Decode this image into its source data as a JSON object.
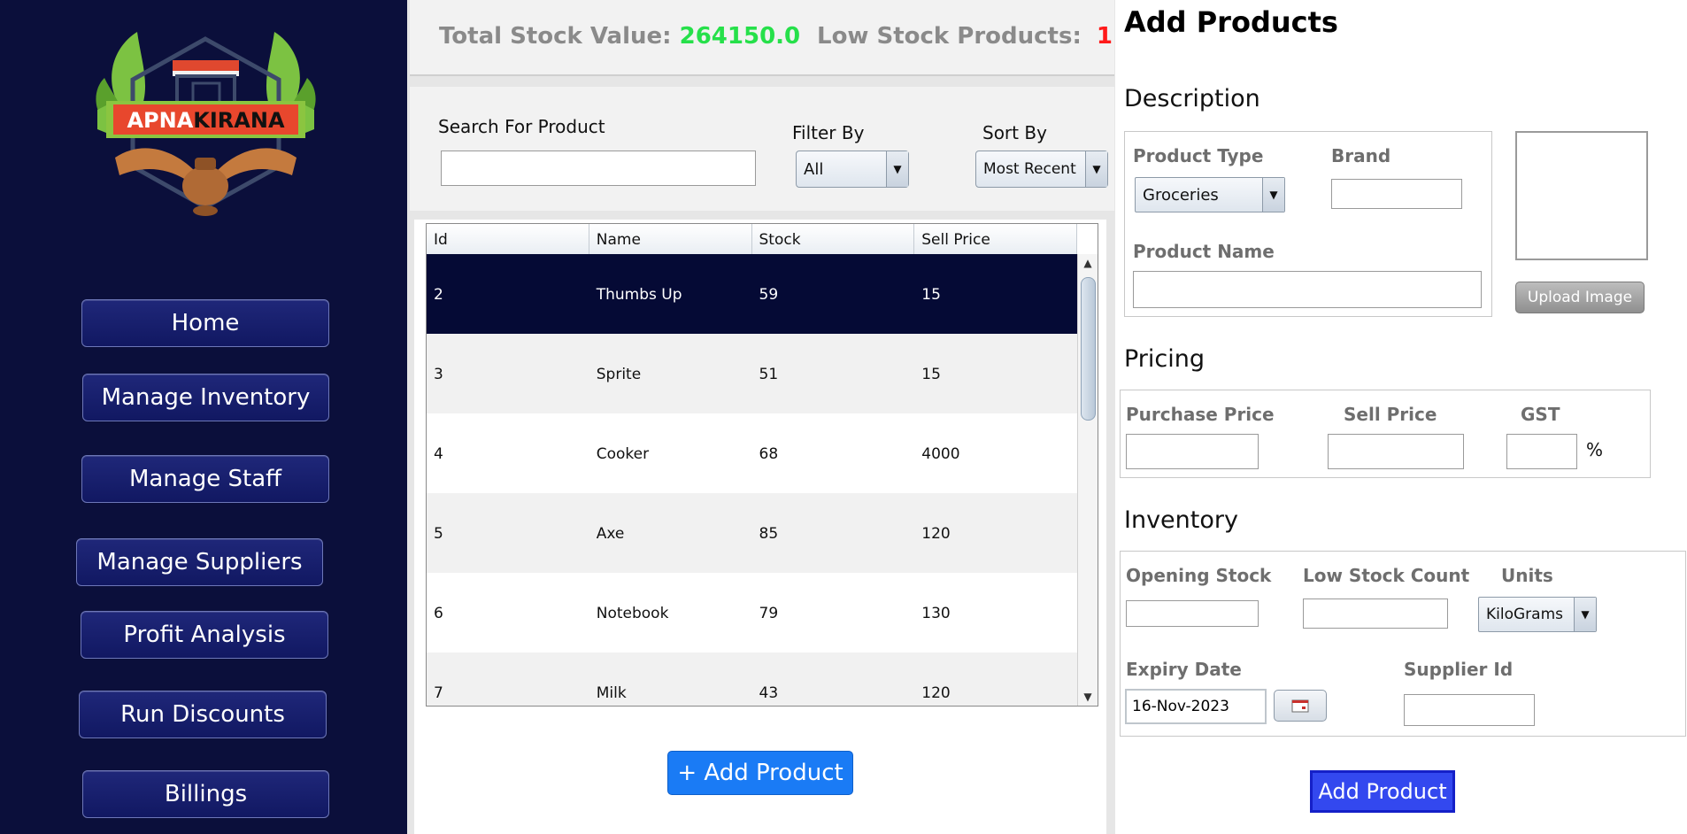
{
  "brand": {
    "name": "APNAKIRANA",
    "prefix": "APNA",
    "suffix": "KIRANA"
  },
  "sidebar": {
    "items": [
      {
        "label": "Home"
      },
      {
        "label": "Manage Inventory"
      },
      {
        "label": "Manage Staff"
      },
      {
        "label": "Manage Suppliers"
      },
      {
        "label": "Profit Analysis"
      },
      {
        "label": "Run Discounts"
      },
      {
        "label": "Billings"
      }
    ]
  },
  "stats": {
    "total_label": "Total Stock Value:",
    "total_value": "264150.0",
    "low_label": "Low Stock Products:",
    "low_value": "1"
  },
  "filters": {
    "search_label": "Search For Product",
    "search_value": "",
    "filter_label": "Filter By",
    "filter_value": "All",
    "sort_label": "Sort By",
    "sort_value": "Most Recent"
  },
  "table": {
    "columns": [
      "Id",
      "Name",
      "Stock",
      "Sell Price"
    ],
    "rows": [
      [
        "2",
        "Thumbs Up",
        "59",
        "15"
      ],
      [
        "3",
        "Sprite",
        "51",
        "15"
      ],
      [
        "4",
        "Cooker",
        "68",
        "4000"
      ],
      [
        "5",
        "Axe",
        "85",
        "120"
      ],
      [
        "6",
        "Notebook",
        "79",
        "130"
      ],
      [
        "7",
        "Milk",
        "43",
        "120"
      ]
    ],
    "selected_row": 0
  },
  "middle": {
    "add_button": "+ Add Product"
  },
  "form": {
    "title": "Add Products",
    "description": {
      "heading": "Description",
      "product_type_label": "Product Type",
      "product_type_value": "Groceries",
      "brand_label": "Brand",
      "brand_value": "",
      "product_name_label": "Product Name",
      "product_name_value": "",
      "upload_label": "Upload Image"
    },
    "pricing": {
      "heading": "Pricing",
      "purchase_label": "Purchase Price",
      "sell_label": "Sell Price",
      "gst_label": "GST",
      "gst_unit": "%"
    },
    "inventory": {
      "heading": "Inventory",
      "opening_label": "Opening Stock",
      "low_label": "Low Stock Count",
      "units_label": "Units",
      "units_value": "KiloGrams",
      "expiry_label": "Expiry Date",
      "expiry_value": "16-Nov-2023",
      "supplier_label": "Supplier Id"
    },
    "submit": "Add Product"
  },
  "colors": {
    "sidebar": "#0b0f3b",
    "accent_green": "#26e04a",
    "accent_red": "#ff1a1a",
    "primary_blue": "#1a7bf5",
    "submit_blue": "#3348ef"
  }
}
